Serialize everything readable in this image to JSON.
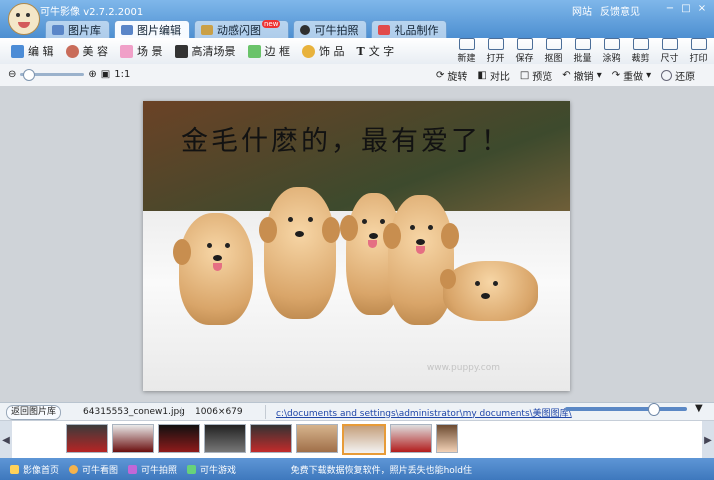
{
  "titlebar": {
    "app_name": "可牛影像",
    "version": "v2.7.2.2001",
    "links": [
      "网站",
      "反馈意见"
    ],
    "buttons": [
      "−",
      "□",
      "×"
    ]
  },
  "main_tabs": [
    {
      "label": "图片库",
      "active": false
    },
    {
      "label": "图片编辑",
      "active": true
    },
    {
      "label": "动感闪图",
      "active": false
    },
    {
      "label": "可牛拍照",
      "active": false
    },
    {
      "label": "礼品制作",
      "active": false
    }
  ],
  "tool_tabs": [
    "编 辑",
    "美 容",
    "场 景",
    "高清场景",
    "边 框",
    "饰 品",
    "文 字"
  ],
  "right_tools": [
    "新建",
    "打开",
    "保存",
    "抠图",
    "批量",
    "涂鸦",
    "裁剪",
    "尺寸",
    "打印"
  ],
  "zoom": {
    "label": "1:1",
    "level": 0.05
  },
  "view_tools": {
    "rotate": "旋转",
    "compare": "对比",
    "preview": "预览",
    "undo": "撤销",
    "redo": "重做",
    "restore": "还原"
  },
  "photo": {
    "caption": "金毛什麽的，最有爱了！",
    "watermark": "www.puppy.com"
  },
  "info": {
    "back_label": "返回图片库",
    "filename": "64315553_conew1.jpg",
    "dimensions": "1006×679",
    "path": "c:\\documents and settings\\administrator\\my documents\\美图图库\\",
    "thumb_slider": 0.74
  },
  "thumbnails": 9,
  "statusbar": {
    "items": [
      "影像首页",
      "可牛看图",
      "可牛拍照",
      "可牛游戏"
    ],
    "promo": "免费下载数据恢复软件，照片丢失也能hold住"
  },
  "colors": {
    "accent": "#4d8fd1",
    "status": "#3e78bd"
  }
}
